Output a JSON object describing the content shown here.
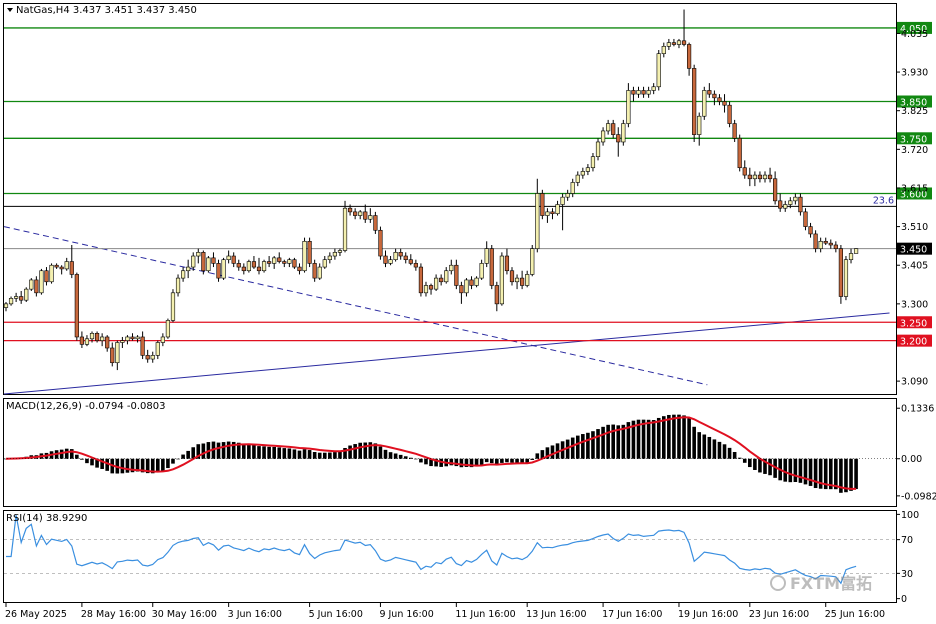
{
  "header": {
    "symbol_line": "NatGas,H4  3.437 3.451 3.437 3.450",
    "macd_line": "MACD(12,26,9) -0.0794 -0.0803",
    "rsi_line": "RSI(14) 38.9290"
  },
  "watermark": "FXTM富拓",
  "colors": {
    "bull_candle": "#f4f0b0",
    "bear_candle": "#c8683c",
    "support_line": "#e01020",
    "resistance_line": "#118811",
    "trend_line": "#2a2aa0",
    "macd_signal": "#e01020",
    "macd_hist": "#000000",
    "rsi_line": "#3a8fe0"
  },
  "chart_data": [
    {
      "type": "candlestick",
      "title": "NatGas,H4",
      "ohlc_last": {
        "open": 3.437,
        "high": 3.451,
        "low": 3.437,
        "close": 3.45
      },
      "ylim": [
        3.055,
        4.115
      ],
      "price_ticks": [
        "4.035",
        "3.930",
        "3.825",
        "3.720",
        "3.615",
        "3.510",
        "3.405",
        "3.300",
        "3.090"
      ],
      "time_labels": [
        "26 May 2025",
        "28 May 16:00",
        "30 May 16:00",
        "3 Jun 16:00",
        "5 Jun 16:00",
        "9 Jun 16:00",
        "11 Jun 16:00",
        "13 Jun 16:00",
        "17 Jun 16:00",
        "19 Jun 16:00",
        "23 Jun 16:00",
        "25 Jun 16:00"
      ],
      "time_label_bars": [
        0,
        15,
        29,
        44,
        60,
        74,
        89,
        103,
        118,
        133,
        147,
        162
      ],
      "level_lines": [
        {
          "label": "4.050",
          "value": 4.05,
          "kind": "resistance"
        },
        {
          "label": "3.850",
          "value": 3.85,
          "kind": "resistance"
        },
        {
          "label": "3.750",
          "value": 3.75,
          "kind": "resistance"
        },
        {
          "label": "3.600",
          "value": 3.6,
          "kind": "resistance"
        },
        {
          "label": "3.250",
          "value": 3.25,
          "kind": "support"
        },
        {
          "label": "3.200",
          "value": 3.2,
          "kind": "support"
        }
      ],
      "fib_line": {
        "label": "23.6",
        "value": 3.565
      },
      "current_price": {
        "label": "3.450",
        "value": 3.45
      },
      "trendlines": [
        {
          "style": "dashed",
          "from": {
            "bar": 0,
            "price": 3.51
          },
          "to": {
            "bar": 139,
            "price": 3.08
          }
        },
        {
          "style": "solid",
          "from": {
            "bar": 0,
            "price": 3.055
          },
          "to": {
            "bar": 175,
            "price": 3.275
          }
        }
      ],
      "candles": [
        [
          3.29,
          3.305,
          3.28,
          3.3
        ],
        [
          3.3,
          3.32,
          3.295,
          3.315
        ],
        [
          3.315,
          3.33,
          3.305,
          3.32
        ],
        [
          3.32,
          3.335,
          3.3,
          3.31
        ],
        [
          3.31,
          3.345,
          3.305,
          3.34
        ],
        [
          3.34,
          3.37,
          3.335,
          3.365
        ],
        [
          3.365,
          3.375,
          3.32,
          3.33
        ],
        [
          3.33,
          3.395,
          3.325,
          3.39
        ],
        [
          3.39,
          3.4,
          3.35,
          3.36
        ],
        [
          3.36,
          3.41,
          3.355,
          3.405
        ],
        [
          3.405,
          3.41,
          3.395,
          3.4
        ],
        [
          3.4,
          3.405,
          3.38,
          3.395
        ],
        [
          3.395,
          3.425,
          3.39,
          3.415
        ],
        [
          3.415,
          3.46,
          3.37,
          3.38
        ],
        [
          3.38,
          3.385,
          3.2,
          3.21
        ],
        [
          3.21,
          3.225,
          3.18,
          3.19
        ],
        [
          3.19,
          3.215,
          3.185,
          3.205
        ],
        [
          3.205,
          3.225,
          3.195,
          3.22
        ],
        [
          3.22,
          3.225,
          3.195,
          3.2
        ],
        [
          3.2,
          3.22,
          3.185,
          3.21
        ],
        [
          3.21,
          3.215,
          3.17,
          3.18
        ],
        [
          3.18,
          3.195,
          3.13,
          3.14
        ],
        [
          3.14,
          3.2,
          3.12,
          3.195
        ],
        [
          3.195,
          3.21,
          3.18,
          3.2
        ],
        [
          3.2,
          3.215,
          3.19,
          3.21
        ],
        [
          3.21,
          3.22,
          3.2,
          3.205
        ],
        [
          3.205,
          3.215,
          3.195,
          3.21
        ],
        [
          3.21,
          3.225,
          3.15,
          3.16
        ],
        [
          3.16,
          3.175,
          3.14,
          3.15
        ],
        [
          3.15,
          3.17,
          3.14,
          3.16
        ],
        [
          3.16,
          3.2,
          3.15,
          3.195
        ],
        [
          3.195,
          3.22,
          3.185,
          3.21
        ],
        [
          3.21,
          3.26,
          3.205,
          3.255
        ],
        [
          3.255,
          3.34,
          3.25,
          3.33
        ],
        [
          3.33,
          3.38,
          3.32,
          3.37
        ],
        [
          3.37,
          3.4,
          3.36,
          3.39
        ],
        [
          3.39,
          3.42,
          3.37,
          3.4
        ],
        [
          3.4,
          3.44,
          3.39,
          3.43
        ],
        [
          3.43,
          3.45,
          3.41,
          3.44
        ],
        [
          3.44,
          3.445,
          3.38,
          3.39
        ],
        [
          3.39,
          3.43,
          3.385,
          3.425
        ],
        [
          3.425,
          3.44,
          3.4,
          3.41
        ],
        [
          3.41,
          3.42,
          3.36,
          3.37
        ],
        [
          3.37,
          3.425,
          3.365,
          3.42
        ],
        [
          3.42,
          3.445,
          3.41,
          3.43
        ],
        [
          3.43,
          3.44,
          3.4,
          3.41
        ],
        [
          3.41,
          3.42,
          3.39,
          3.4
        ],
        [
          3.4,
          3.41,
          3.38,
          3.39
        ],
        [
          3.39,
          3.42,
          3.385,
          3.415
        ],
        [
          3.415,
          3.43,
          3.395,
          3.4
        ],
        [
          3.4,
          3.425,
          3.38,
          3.39
        ],
        [
          3.39,
          3.42,
          3.385,
          3.415
        ],
        [
          3.415,
          3.43,
          3.4,
          3.41
        ],
        [
          3.41,
          3.43,
          3.395,
          3.425
        ],
        [
          3.425,
          3.44,
          3.41,
          3.415
        ],
        [
          3.415,
          3.42,
          3.4,
          3.41
        ],
        [
          3.41,
          3.425,
          3.4,
          3.42
        ],
        [
          3.42,
          3.425,
          3.395,
          3.4
        ],
        [
          3.4,
          3.41,
          3.38,
          3.39
        ],
        [
          3.39,
          3.48,
          3.385,
          3.47
        ],
        [
          3.47,
          3.48,
          3.4,
          3.41
        ],
        [
          3.41,
          3.42,
          3.36,
          3.37
        ],
        [
          3.37,
          3.41,
          3.365,
          3.4
        ],
        [
          3.4,
          3.43,
          3.395,
          3.42
        ],
        [
          3.42,
          3.44,
          3.41,
          3.43
        ],
        [
          3.43,
          3.45,
          3.42,
          3.44
        ],
        [
          3.44,
          3.45,
          3.43,
          3.445
        ],
        [
          3.445,
          3.58,
          3.44,
          3.56
        ],
        [
          3.56,
          3.57,
          3.54,
          3.55
        ],
        [
          3.55,
          3.56,
          3.53,
          3.54
        ],
        [
          3.54,
          3.555,
          3.53,
          3.55
        ],
        [
          3.55,
          3.57,
          3.52,
          3.53
        ],
        [
          3.53,
          3.56,
          3.52,
          3.54
        ],
        [
          3.54,
          3.55,
          3.49,
          3.5
        ],
        [
          3.5,
          3.51,
          3.42,
          3.43
        ],
        [
          3.43,
          3.445,
          3.4,
          3.41
        ],
        [
          3.41,
          3.43,
          3.405,
          3.42
        ],
        [
          3.42,
          3.45,
          3.415,
          3.44
        ],
        [
          3.44,
          3.45,
          3.42,
          3.43
        ],
        [
          3.43,
          3.44,
          3.41,
          3.42
        ],
        [
          3.42,
          3.435,
          3.405,
          3.41
        ],
        [
          3.41,
          3.42,
          3.39,
          3.4
        ],
        [
          3.4,
          3.41,
          3.32,
          3.33
        ],
        [
          3.33,
          3.36,
          3.32,
          3.35
        ],
        [
          3.35,
          3.355,
          3.325,
          3.34
        ],
        [
          3.34,
          3.38,
          3.335,
          3.37
        ],
        [
          3.37,
          3.38,
          3.35,
          3.36
        ],
        [
          3.36,
          3.4,
          3.355,
          3.39
        ],
        [
          3.39,
          3.42,
          3.38,
          3.405
        ],
        [
          3.405,
          3.42,
          3.34,
          3.35
        ],
        [
          3.35,
          3.36,
          3.3,
          3.33
        ],
        [
          3.33,
          3.37,
          3.32,
          3.365
        ],
        [
          3.365,
          3.375,
          3.34,
          3.35
        ],
        [
          3.35,
          3.375,
          3.345,
          3.37
        ],
        [
          3.37,
          3.42,
          3.365,
          3.41
        ],
        [
          3.41,
          3.47,
          3.4,
          3.45
        ],
        [
          3.45,
          3.46,
          3.34,
          3.35
        ],
        [
          3.35,
          3.36,
          3.28,
          3.3
        ],
        [
          3.3,
          3.44,
          3.295,
          3.43
        ],
        [
          3.43,
          3.45,
          3.38,
          3.39
        ],
        [
          3.39,
          3.4,
          3.35,
          3.36
        ],
        [
          3.36,
          3.38,
          3.34,
          3.37
        ],
        [
          3.37,
          3.39,
          3.34,
          3.35
        ],
        [
          3.35,
          3.39,
          3.345,
          3.38
        ],
        [
          3.38,
          3.46,
          3.375,
          3.45
        ],
        [
          3.45,
          3.64,
          3.44,
          3.6
        ],
        [
          3.6,
          3.61,
          3.53,
          3.54
        ],
        [
          3.54,
          3.56,
          3.52,
          3.55
        ],
        [
          3.55,
          3.56,
          3.53,
          3.545
        ],
        [
          3.545,
          3.58,
          3.54,
          3.57
        ],
        [
          3.57,
          3.6,
          3.5,
          3.59
        ],
        [
          3.59,
          3.61,
          3.58,
          3.6
        ],
        [
          3.6,
          3.64,
          3.59,
          3.63
        ],
        [
          3.63,
          3.66,
          3.62,
          3.65
        ],
        [
          3.65,
          3.67,
          3.64,
          3.66
        ],
        [
          3.66,
          3.68,
          3.65,
          3.67
        ],
        [
          3.67,
          3.71,
          3.66,
          3.7
        ],
        [
          3.7,
          3.75,
          3.69,
          3.74
        ],
        [
          3.74,
          3.78,
          3.73,
          3.77
        ],
        [
          3.77,
          3.8,
          3.76,
          3.79
        ],
        [
          3.79,
          3.8,
          3.75,
          3.76
        ],
        [
          3.76,
          3.78,
          3.7,
          3.74
        ],
        [
          3.74,
          3.8,
          3.73,
          3.79
        ],
        [
          3.79,
          3.9,
          3.78,
          3.88
        ],
        [
          3.88,
          3.89,
          3.85,
          3.87
        ],
        [
          3.87,
          3.89,
          3.86,
          3.88
        ],
        [
          3.88,
          3.89,
          3.86,
          3.87
        ],
        [
          3.87,
          3.89,
          3.86,
          3.88
        ],
        [
          3.88,
          3.9,
          3.87,
          3.89
        ],
        [
          3.89,
          3.99,
          3.88,
          3.98
        ],
        [
          3.98,
          4.01,
          3.97,
          4.0
        ],
        [
          4.0,
          4.02,
          3.99,
          4.01
        ],
        [
          4.01,
          4.02,
          4.0,
          4.005
        ],
        [
          4.005,
          4.02,
          3.995,
          4.015
        ],
        [
          4.015,
          4.1,
          4.0,
          4.005
        ],
        [
          4.005,
          4.01,
          3.92,
          3.94
        ],
        [
          3.94,
          3.95,
          3.74,
          3.76
        ],
        [
          3.76,
          3.82,
          3.73,
          3.81
        ],
        [
          3.81,
          3.89,
          3.8,
          3.88
        ],
        [
          3.88,
          3.9,
          3.86,
          3.87
        ],
        [
          3.87,
          3.88,
          3.84,
          3.86
        ],
        [
          3.86,
          3.87,
          3.84,
          3.85
        ],
        [
          3.85,
          3.87,
          3.82,
          3.84
        ],
        [
          3.84,
          3.85,
          3.78,
          3.79
        ],
        [
          3.79,
          3.8,
          3.74,
          3.75
        ],
        [
          3.75,
          3.76,
          3.66,
          3.67
        ],
        [
          3.67,
          3.69,
          3.64,
          3.65
        ],
        [
          3.65,
          3.67,
          3.62,
          3.64
        ],
        [
          3.64,
          3.66,
          3.62,
          3.65
        ],
        [
          3.65,
          3.66,
          3.63,
          3.64
        ],
        [
          3.64,
          3.66,
          3.63,
          3.65
        ],
        [
          3.65,
          3.67,
          3.63,
          3.64
        ],
        [
          3.64,
          3.66,
          3.57,
          3.58
        ],
        [
          3.58,
          3.6,
          3.55,
          3.56
        ],
        [
          3.56,
          3.58,
          3.55,
          3.57
        ],
        [
          3.57,
          3.59,
          3.56,
          3.58
        ],
        [
          3.58,
          3.6,
          3.57,
          3.59
        ],
        [
          3.59,
          3.6,
          3.54,
          3.55
        ],
        [
          3.55,
          3.56,
          3.5,
          3.51
        ],
        [
          3.51,
          3.52,
          3.48,
          3.49
        ],
        [
          3.49,
          3.5,
          3.44,
          3.45
        ],
        [
          3.45,
          3.48,
          3.44,
          3.47
        ],
        [
          3.47,
          3.48,
          3.46,
          3.465
        ],
        [
          3.465,
          3.475,
          3.45,
          3.46
        ],
        [
          3.46,
          3.47,
          3.44,
          3.45
        ],
        [
          3.45,
          3.46,
          3.3,
          3.32
        ],
        [
          3.32,
          3.43,
          3.31,
          3.42
        ],
        [
          3.42,
          3.45,
          3.41,
          3.437
        ],
        [
          3.437,
          3.451,
          3.437,
          3.45
        ]
      ]
    },
    {
      "type": "bar",
      "title": "MACD(12,26,9)",
      "values_label": {
        "main": -0.0794,
        "signal": -0.0803
      },
      "ylim": [
        -0.125,
        0.158
      ],
      "y_ticks": [
        "0.1336",
        "0.00",
        "-0.0982"
      ]
    },
    {
      "type": "line",
      "title": "RSI(14)",
      "last_value": 38.929,
      "ylim": [
        -4,
        104
      ],
      "y_ticks": [
        "100",
        "70",
        "30",
        "0"
      ]
    }
  ]
}
